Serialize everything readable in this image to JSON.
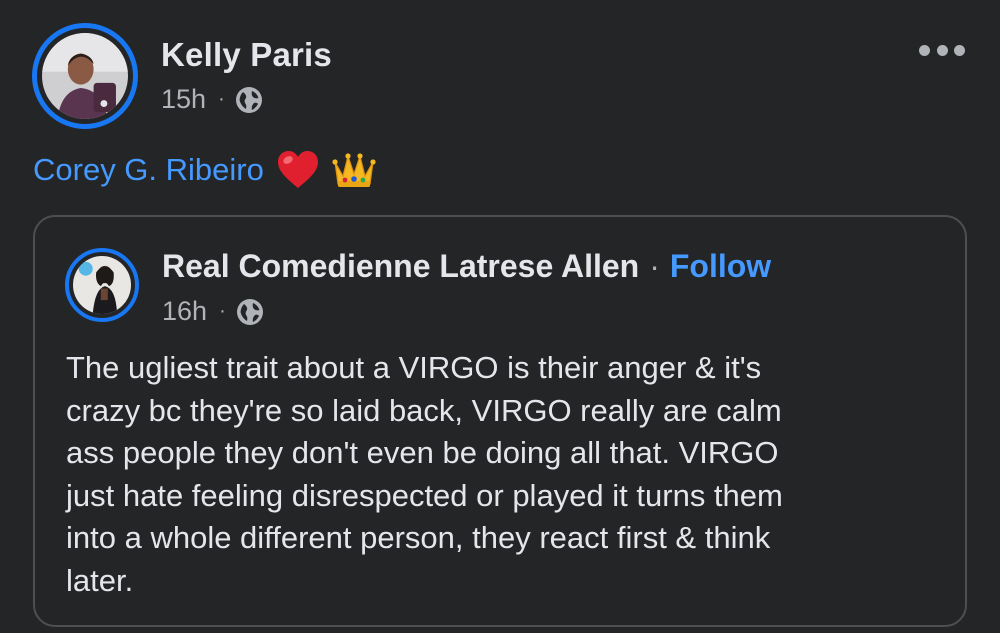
{
  "post": {
    "author": "Kelly Paris",
    "time": "15h",
    "separator": "·",
    "privacy_icon": "globe-icon",
    "mention": "Corey G. Ribeiro",
    "emojis": [
      "red-heart-emoji",
      "crown-emoji"
    ]
  },
  "shared_post": {
    "author": "Real Comedienne Latrese Allen",
    "separator": "·",
    "follow_label": "Follow",
    "time": "16h",
    "privacy_icon": "globe-icon",
    "body": "The ugliest trait about a VIRGO is their anger & it's\ncrazy bc they're so laid back, VIRGO really are calm\nass people they don't even be doing all that. VIRGO\njust hate feeling disrespected or played it turns them\ninto a whole different person, they react first & think\nlater."
  },
  "colors": {
    "background": "#242526",
    "accent": "#1877f2",
    "link": "#4599ff",
    "text_primary": "#e4e6eb",
    "text_secondary": "#b0b3b8",
    "card_border": "#4e4f50"
  }
}
